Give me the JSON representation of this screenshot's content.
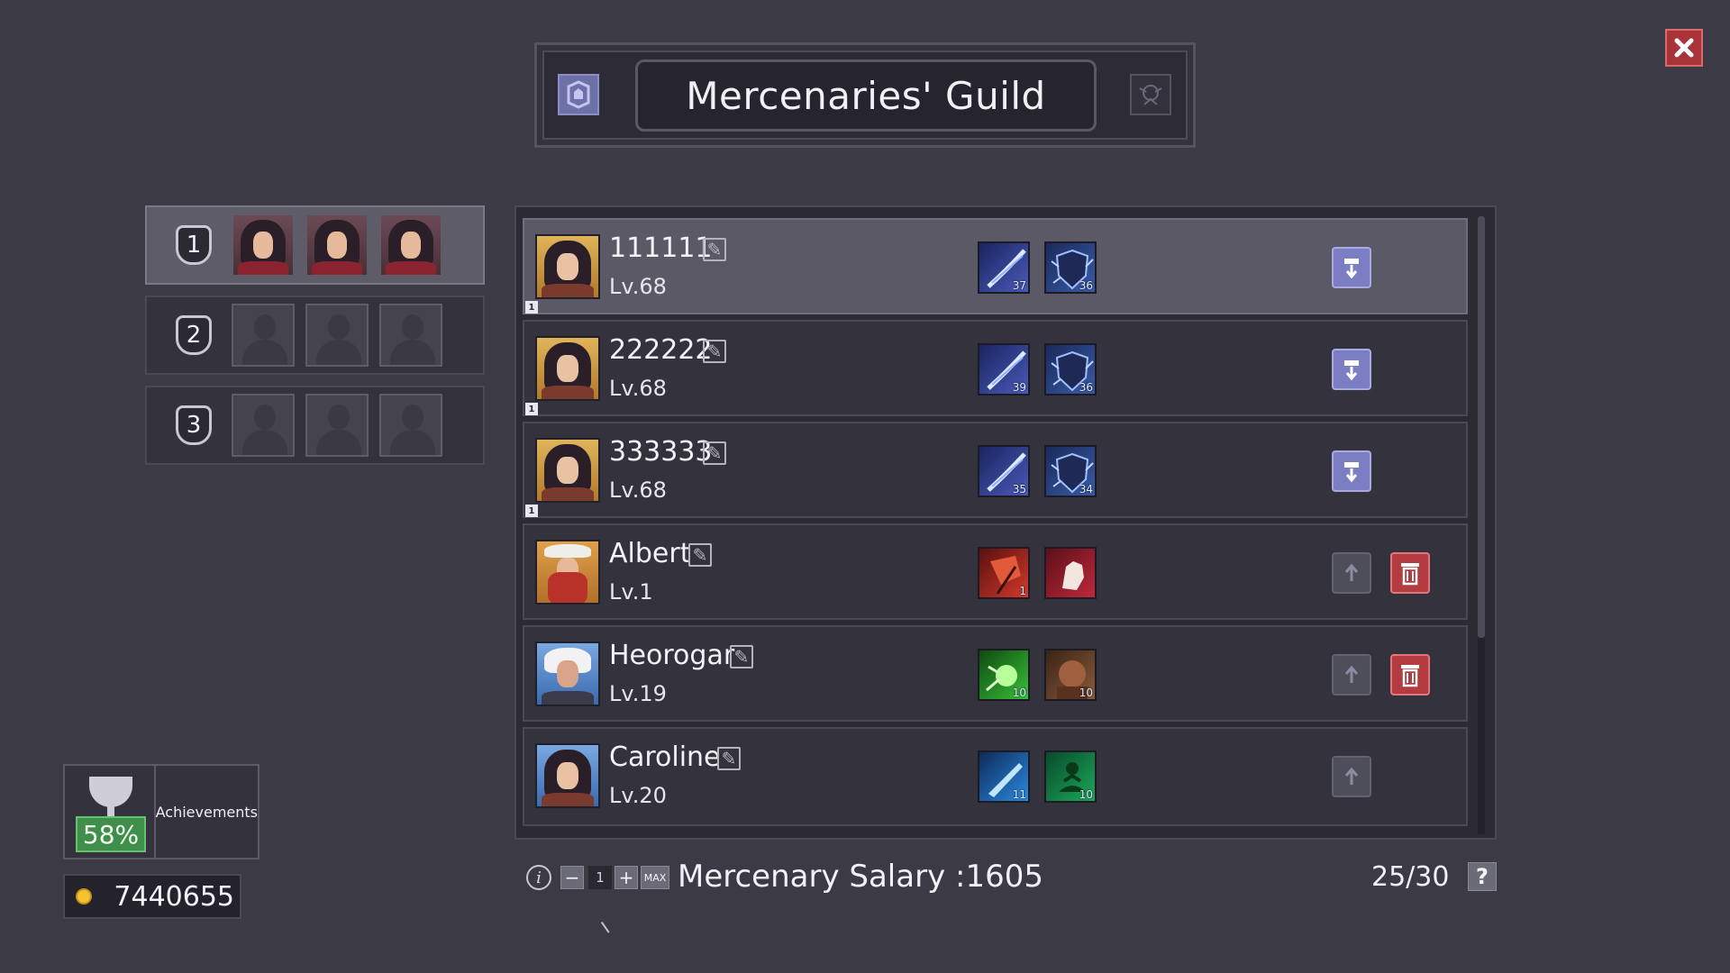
{
  "header": {
    "title": "Mercenaries' Guild"
  },
  "close_icon": "close-icon",
  "parties": [
    {
      "number": "1",
      "members": [
        "portrait-female",
        "portrait-female",
        "portrait-female"
      ],
      "active": true
    },
    {
      "number": "2",
      "members": [
        "empty",
        "empty",
        "empty"
      ],
      "active": false
    },
    {
      "number": "3",
      "members": [
        "empty",
        "empty",
        "empty"
      ],
      "active": false
    }
  ],
  "mercenaries": [
    {
      "name": "111111",
      "level": "Lv.68",
      "team": "1",
      "portrait": "female-dark-hair",
      "skills": [
        {
          "icon": "sword-slash-icon",
          "level": "37"
        },
        {
          "icon": "shield-lightning-icon",
          "level": "36"
        }
      ],
      "actions": [
        "assign"
      ]
    },
    {
      "name": "222222",
      "level": "Lv.68",
      "team": "1",
      "portrait": "female-dark-hair",
      "skills": [
        {
          "icon": "sword-slash-icon",
          "level": "39"
        },
        {
          "icon": "shield-lightning-icon",
          "level": "36"
        }
      ],
      "actions": [
        "assign"
      ]
    },
    {
      "name": "333333",
      "level": "Lv.68",
      "team": "1",
      "portrait": "female-dark-hair",
      "skills": [
        {
          "icon": "sword-slash-icon",
          "level": "35"
        },
        {
          "icon": "shield-lightning-icon",
          "level": "34"
        }
      ],
      "actions": [
        "assign"
      ]
    },
    {
      "name": "Albert",
      "level": "Lv.1",
      "team": "",
      "portrait": "dwarf-red-beard",
      "skills": [
        {
          "icon": "axe-strike-icon",
          "level": "1"
        },
        {
          "icon": "fist-punch-icon",
          "level": ""
        }
      ],
      "actions": [
        "unassign",
        "delete"
      ]
    },
    {
      "name": "Heorogar",
      "level": "Lv.19",
      "team": "",
      "portrait": "white-hair-warrior",
      "skills": [
        {
          "icon": "green-burst-icon",
          "level": "10"
        },
        {
          "icon": "brute-face-icon",
          "level": "10"
        }
      ],
      "actions": [
        "unassign",
        "delete"
      ]
    },
    {
      "name": "Caroline",
      "level": "Lv.20",
      "team": "",
      "portrait": "female-dark-hair",
      "skills": [
        {
          "icon": "blue-blade-icon",
          "level": "11"
        },
        {
          "icon": "meditation-icon",
          "level": "10"
        }
      ],
      "actions": [
        "unassign"
      ]
    }
  ],
  "achievements": {
    "label": "Achievements",
    "percent": "58%"
  },
  "gold": {
    "value": "7440655"
  },
  "footer": {
    "quantity": "1",
    "minus_label": "−",
    "plus_label": "+",
    "max_label": "MAX",
    "salary": "Mercenary Salary :1605",
    "capacity": "25/30",
    "help_label": "?"
  },
  "colors": {
    "background": "#3b3a45",
    "assign_button": "#7b7ec2",
    "delete_button": "#b43b3f",
    "achievement_green": "#3f8f4a",
    "close_red": "#a8343a"
  }
}
